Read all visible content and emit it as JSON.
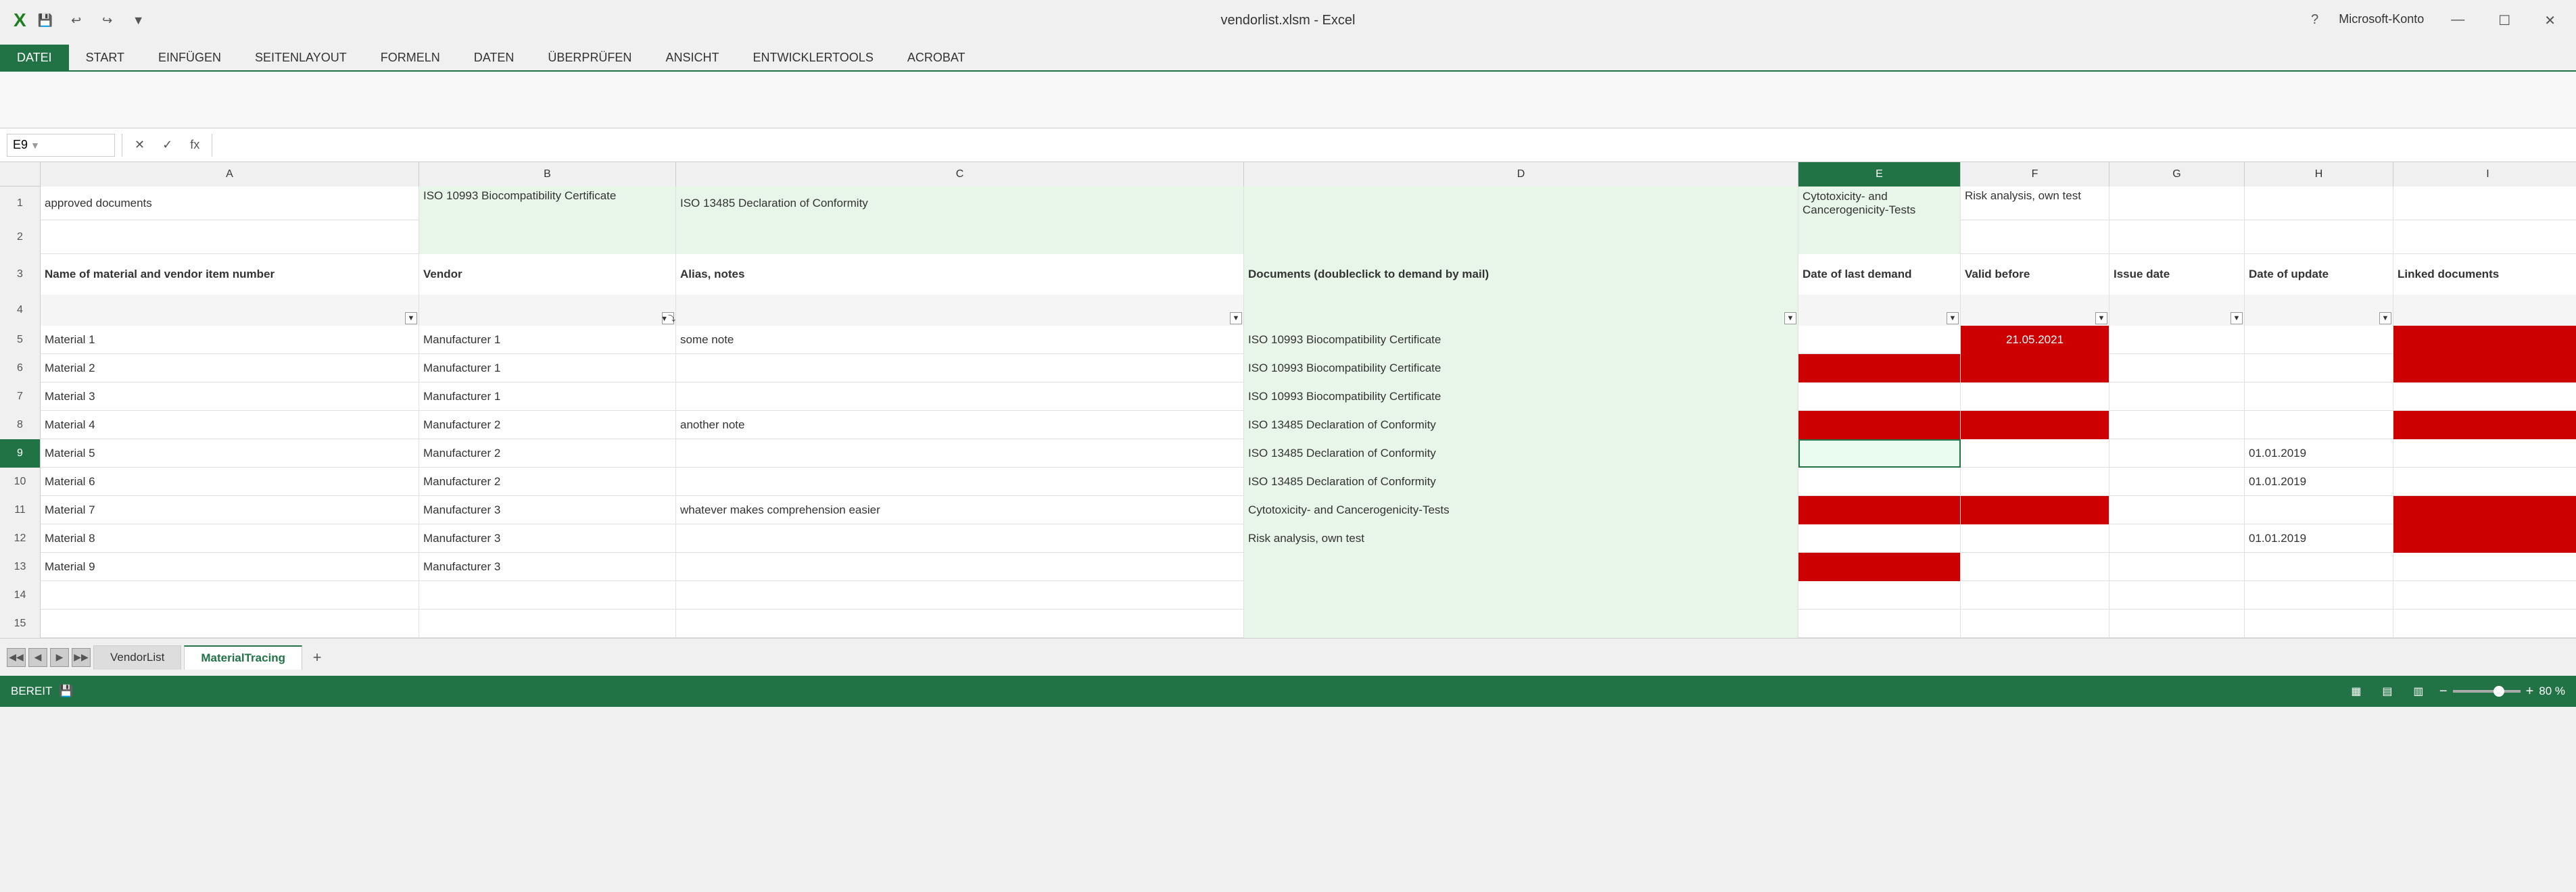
{
  "titleBar": {
    "title": "vendorlist.xlsm - Excel",
    "appName": "X",
    "minimize": "—",
    "maximize": "☐",
    "close": "✕",
    "help": "?"
  },
  "ribbon": {
    "tabs": [
      {
        "label": "DATEI",
        "active": true
      },
      {
        "label": "START"
      },
      {
        "label": "EINFÜGEN"
      },
      {
        "label": "SEITENLAYOUT"
      },
      {
        "label": "FORMELN"
      },
      {
        "label": "DATEN"
      },
      {
        "label": "ÜBERPRÜFEN"
      },
      {
        "label": "ANSICHT"
      },
      {
        "label": "ENTWICKLERTOOLS"
      },
      {
        "label": "ACROBAT"
      }
    ],
    "userAccount": "Microsoft-Konto"
  },
  "formulaBar": {
    "cellRef": "E9",
    "icons": [
      "✕",
      "✓",
      "fx"
    ],
    "value": ""
  },
  "columns": {
    "headers": [
      "",
      "A",
      "B",
      "C",
      "D",
      "E",
      "F",
      "G",
      "H"
    ],
    "row1_labels": [
      "approved documents",
      "ISO 10993 Biocompatibility Certificate",
      "ISO 13485 Declaration of Conformity",
      "",
      "Cytotoxicity- and Cancerogenicity-Tests",
      "Risk analysis, own test",
      "",
      "",
      ""
    ]
  },
  "rows": {
    "row3_headers": [
      "Name of material and vendor item number",
      "Vendor",
      "Alias, notes",
      "",
      "Documents (doubleclick to demand by mail)",
      "Date of last demand",
      "Valid before",
      "Issue date",
      "Date of update",
      "Linked documents"
    ],
    "data": [
      {
        "rowNum": "5",
        "A": "Material 1",
        "B": "Manufacturer 1",
        "C": "some note",
        "D": "ISO 10993 Biocompatibility Certificate",
        "E": "",
        "F": "21.05.2021",
        "G": "",
        "H": "",
        "I": ""
      },
      {
        "rowNum": "6",
        "A": "Material 2",
        "B": "Manufacturer 1",
        "C": "",
        "D": "ISO 10993 Biocompatibility Certificate",
        "E": "",
        "F": "",
        "G": "",
        "H": "",
        "I": ""
      },
      {
        "rowNum": "7",
        "A": "Material 3",
        "B": "Manufacturer 1",
        "C": "",
        "D": "ISO 10993 Biocompatibility Certificate",
        "E": "",
        "F": "",
        "G": "",
        "H": "",
        "I": ""
      },
      {
        "rowNum": "8",
        "A": "Material 4",
        "B": "Manufacturer 2",
        "C": "another note",
        "D": "ISO 13485 Declaration of Conformity",
        "E": "",
        "F": "",
        "G": "",
        "H": "",
        "I": ""
      },
      {
        "rowNum": "9",
        "A": "Material 5",
        "B": "Manufacturer 2",
        "C": "",
        "D": "ISO 13485 Declaration of Conformity",
        "E": "SELECTED",
        "F": "",
        "G": "",
        "H": "01.01.2019",
        "I": ""
      },
      {
        "rowNum": "10",
        "A": "Material 6",
        "B": "Manufacturer 2",
        "C": "",
        "D": "ISO 13485 Declaration of Conformity",
        "E": "",
        "F": "",
        "G": "",
        "H": "01.01.2019",
        "I": ""
      },
      {
        "rowNum": "11",
        "A": "Material 7",
        "B": "Manufacturer 3",
        "C": "whatever makes comprehension easier",
        "D": "Cytotoxicity- and Cancerogenicity-Tests",
        "E": "",
        "F": "",
        "G": "",
        "H": "",
        "I": ""
      },
      {
        "rowNum": "12",
        "A": "Material 8",
        "B": "Manufacturer 3",
        "C": "",
        "D": "Risk analysis, own test",
        "E": "",
        "F": "",
        "G": "",
        "H": "01.01.2019",
        "I": ""
      },
      {
        "rowNum": "13",
        "A": "Material 9",
        "B": "Manufacturer 3",
        "C": "",
        "D": "",
        "E": "",
        "F": "",
        "G": "",
        "H": "",
        "I": ""
      },
      {
        "rowNum": "14",
        "A": "",
        "B": "",
        "C": "",
        "D": "",
        "E": "",
        "F": "",
        "G": "",
        "H": "",
        "I": ""
      },
      {
        "rowNum": "15",
        "A": "",
        "B": "",
        "C": "",
        "D": "",
        "E": "",
        "F": "",
        "G": "",
        "H": "",
        "I": ""
      }
    ]
  },
  "sheetTabs": {
    "tabs": [
      "VendorList",
      "MaterialTracing"
    ],
    "activeTab": "MaterialTracing",
    "addIcon": "+"
  },
  "statusBar": {
    "ready": "BEREIT",
    "icons": [
      "📄",
      "▦",
      "▤",
      "▥"
    ],
    "zoom": "80 %",
    "zoomMinus": "−",
    "zoomPlus": "+"
  },
  "colors": {
    "excelGreen": "#217346",
    "lightGreen": "#e8f5e9",
    "red": "#cc0000",
    "selectedBorder": "#217346",
    "headerBg": "#f0f0f0",
    "activeDatei": "#217346"
  }
}
